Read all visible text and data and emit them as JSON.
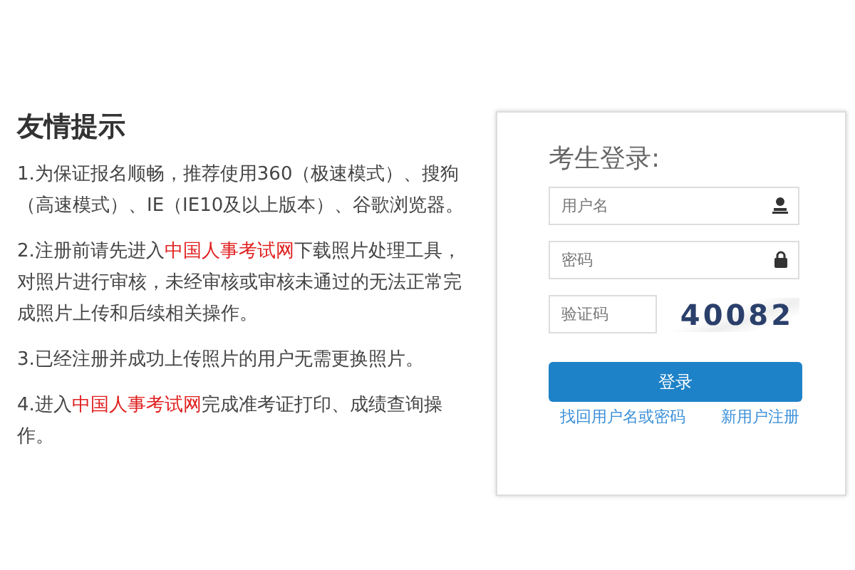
{
  "tips": {
    "title": "友情提示",
    "paragraphs": [
      {
        "segments": [
          {
            "kind": "text",
            "text": "1.为保证报名顺畅，推荐使用360（极速模式）、搜狗（高速模式）、IE（IE10及以上版本）、谷歌浏览器。"
          }
        ]
      },
      {
        "segments": [
          {
            "kind": "text",
            "text": "2.注册前请先进入"
          },
          {
            "kind": "link",
            "text": "中国人事考试网"
          },
          {
            "kind": "text",
            "text": "下载照片处理工具，对照片进行审核，未经审核或审核未通过的无法正常完成照片上传和后续相关操作。"
          }
        ]
      },
      {
        "segments": [
          {
            "kind": "text",
            "text": "3.已经注册并成功上传照片的用户无需更换照片。"
          }
        ]
      },
      {
        "segments": [
          {
            "kind": "text",
            "text": "4.进入"
          },
          {
            "kind": "link",
            "text": "中国人事考试网"
          },
          {
            "kind": "text",
            "text": "完成准考证打印、成绩查询操作。"
          }
        ]
      }
    ]
  },
  "login": {
    "title": "考生登录:",
    "username": {
      "placeholder": "用户名"
    },
    "password": {
      "placeholder": "密码"
    },
    "captcha": {
      "placeholder": "验证码",
      "code": "40082"
    },
    "submit": "登录",
    "links": [
      "找回用户名或密码",
      "新用户注册"
    ]
  }
}
